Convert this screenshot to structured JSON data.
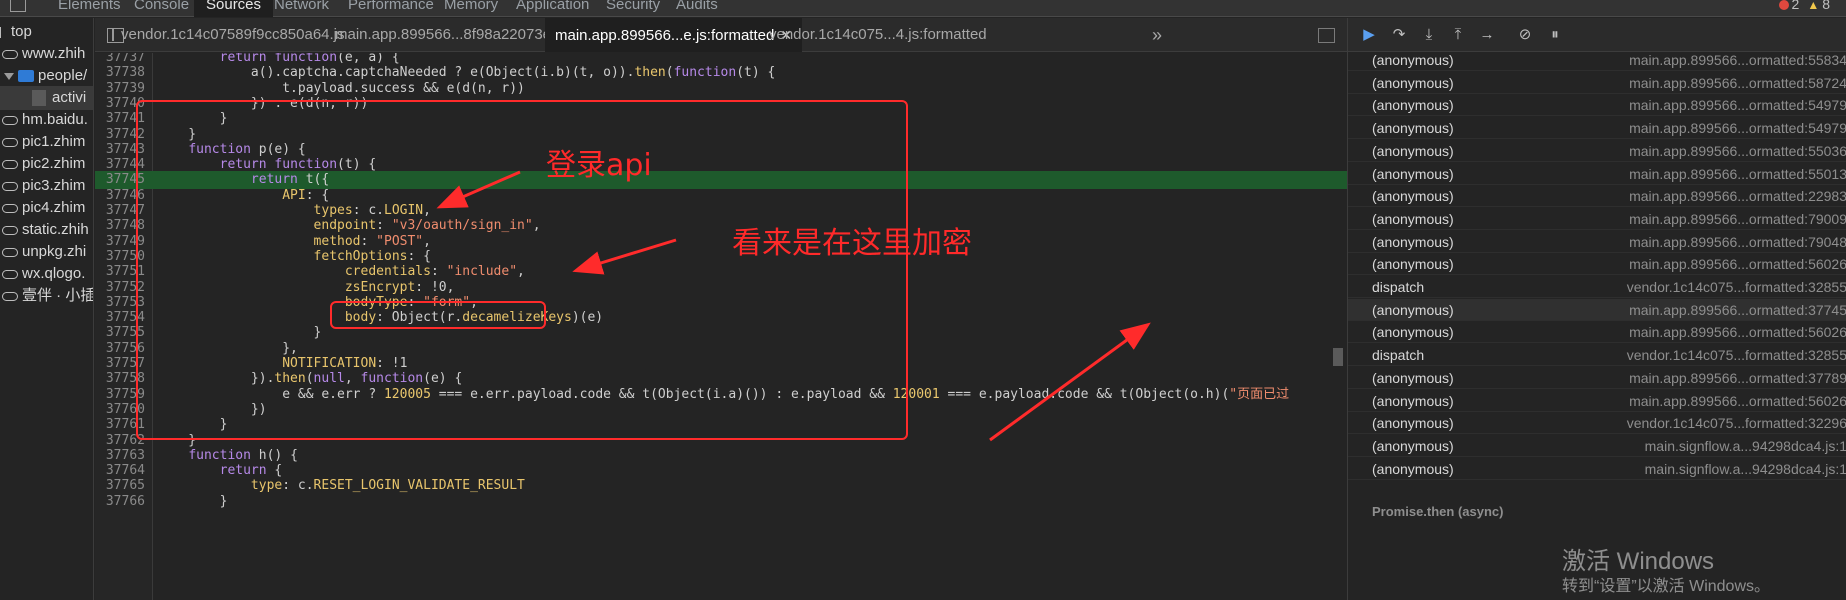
{
  "top_tabs": {
    "items": [
      "Elements",
      "Console",
      "Sources",
      "Network",
      "Performance",
      "Memory",
      "Application",
      "Security",
      "Audits"
    ],
    "active": "Sources",
    "errors": "2",
    "warnings": "8"
  },
  "navigator": {
    "items": [
      {
        "label": "top",
        "icon": "frame-icon"
      },
      {
        "label": "www.zhih",
        "icon": "cloud-icon"
      },
      {
        "label": "people/",
        "icon": "folder-icon"
      },
      {
        "label": "activi",
        "icon": "file-icon"
      },
      {
        "label": "hm.baidu.",
        "icon": "cloud-icon"
      },
      {
        "label": "pic1.zhim",
        "icon": "cloud-icon"
      },
      {
        "label": "pic2.zhim",
        "icon": "cloud-icon"
      },
      {
        "label": "pic3.zhim",
        "icon": "cloud-icon"
      },
      {
        "label": "pic4.zhim",
        "icon": "cloud-icon"
      },
      {
        "label": "static.zhih",
        "icon": "cloud-icon"
      },
      {
        "label": "unpkg.zhi",
        "icon": "cloud-icon"
      },
      {
        "label": "wx.qlogo.",
        "icon": "cloud-icon"
      },
      {
        "label": "壹伴 · 小插",
        "icon": "cloud-icon"
      }
    ]
  },
  "editor_tabs": {
    "items": [
      "vendor.1c14c07589f9cc850a64.js",
      "main.app.899566...8f98a22073e.js",
      "main.app.899566...e.js:formatted",
      "vendor.1c14c075...4.js:formatted"
    ],
    "active_index": 2,
    "more": "»"
  },
  "code": {
    "lines": [
      {
        "n": "37737",
        "html": "        <span class='k'>return</span> <span class='k'>function</span>(e, a) {"
      },
      {
        "n": "37738",
        "html": "            a().captcha.captchaNeeded ? e(Object(i.b)(t, o)).<span class='n'>then</span>(<span class='k'>function</span>(t) {"
      },
      {
        "n": "37739",
        "html": "                t.payload.success &amp;&amp; e(d(n, r))"
      },
      {
        "n": "37740",
        "html": "            }) : e(d(n, r))"
      },
      {
        "n": "37741",
        "html": "        }"
      },
      {
        "n": "37742",
        "html": "    }"
      },
      {
        "n": "37743",
        "html": "    <span class='k'>function</span> p(e) {"
      },
      {
        "n": "37744",
        "html": "        <span class='k'>return</span> <span class='k'>function</span>(t) {"
      },
      {
        "n": "37745",
        "html": "            <span class='k'>return</span> t({"
      },
      {
        "n": "37746",
        "html": "                <span class='p'>API</span>: {"
      },
      {
        "n": "37747",
        "html": "                    <span class='p'>types</span>: c.<span class='p'>LOGIN</span>,"
      },
      {
        "n": "37748",
        "html": "                    <span class='p'>endpoint</span>: <span class='s'>\"v3/oauth/sign_in\"</span>,"
      },
      {
        "n": "37749",
        "html": "                    <span class='p'>method</span>: <span class='s'>\"POST\"</span>,"
      },
      {
        "n": "37750",
        "html": "                    <span class='p'>fetchOptions</span>: {"
      },
      {
        "n": "37751",
        "html": "                        <span class='p'>credentials</span>: <span class='s'>\"include\"</span>,"
      },
      {
        "n": "37752",
        "html": "                        <span class='p'>zsEncrypt</span>: !0,"
      },
      {
        "n": "37753",
        "html": "                        <span class='p'>bodyType</span>: <span class='s'>\"form\"</span>,"
      },
      {
        "n": "37754",
        "html": "                        <span class='p'>body</span>: Object(r.<span class='p'>decamelizeKeys</span>)(e)"
      },
      {
        "n": "37755",
        "html": "                    }"
      },
      {
        "n": "37756",
        "html": "                },"
      },
      {
        "n": "37757",
        "html": "                <span class='p'>NOTIFICATION</span>: !1"
      },
      {
        "n": "37758",
        "html": "            }).<span class='n'>then</span>(<span class='k'>null</span>, <span class='k'>function</span>(e) {"
      },
      {
        "n": "37759",
        "html": "                e &amp;&amp; e.err ? <span class='n'>120005</span> === e.err.payload.code &amp;&amp; t(Object(i.a)()) : e.payload &amp;&amp; <span class='n'>120001</span> === e.payload.code &amp;&amp; t(Object(o.h)(<span class='s'>\"页面已过</span>"
      },
      {
        "n": "37760",
        "html": "            })"
      },
      {
        "n": "37761",
        "html": "        }"
      },
      {
        "n": "37762",
        "html": "    }"
      },
      {
        "n": "37763",
        "html": "    <span class='k'>function</span> h() {"
      },
      {
        "n": "37764",
        "html": "        <span class='k'>return</span> {"
      },
      {
        "n": "37765",
        "html": "            <span class='p'>type</span>: c.<span class='p'>RESET_LOGIN_VALIDATE_RESULT</span>"
      },
      {
        "n": "37766",
        "html": "        }"
      }
    ],
    "highlight_line": "37745"
  },
  "annotations": {
    "login_api": "登录api",
    "encrypt_here": "看来是在这里加密"
  },
  "call_stack": {
    "frames": [
      {
        "fn": "(anonymous)",
        "loc": "main.app.899566...ormatted:55834"
      },
      {
        "fn": "(anonymous)",
        "loc": "main.app.899566...ormatted:58724"
      },
      {
        "fn": "(anonymous)",
        "loc": "main.app.899566...ormatted:54979"
      },
      {
        "fn": "(anonymous)",
        "loc": "main.app.899566...ormatted:54979"
      },
      {
        "fn": "(anonymous)",
        "loc": "main.app.899566...ormatted:55036"
      },
      {
        "fn": "(anonymous)",
        "loc": "main.app.899566...ormatted:55013"
      },
      {
        "fn": "(anonymous)",
        "loc": "main.app.899566...ormatted:22983"
      },
      {
        "fn": "(anonymous)",
        "loc": "main.app.899566...ormatted:79009"
      },
      {
        "fn": "(anonymous)",
        "loc": "main.app.899566...ormatted:79048"
      },
      {
        "fn": "(anonymous)",
        "loc": "main.app.899566...ormatted:56026"
      },
      {
        "fn": "dispatch",
        "loc": "vendor.1c14c075...formatted:32855"
      },
      {
        "fn": "(anonymous)",
        "loc": "main.app.899566...ormatted:37745"
      },
      {
        "fn": "(anonymous)",
        "loc": "main.app.899566...ormatted:56026"
      },
      {
        "fn": "dispatch",
        "loc": "vendor.1c14c075...formatted:32855"
      },
      {
        "fn": "(anonymous)",
        "loc": "main.app.899566...ormatted:37789"
      },
      {
        "fn": "(anonymous)",
        "loc": "main.app.899566...ormatted:56026"
      },
      {
        "fn": "(anonymous)",
        "loc": "vendor.1c14c075...formatted:32296"
      },
      {
        "fn": "(anonymous)",
        "loc": "main.signflow.a...94298dca4.js:1"
      },
      {
        "fn": "(anonymous)",
        "loc": "main.signflow.a...94298dca4.js:1"
      }
    ],
    "selected_index": 11,
    "async_label": "Promise.then (async)"
  },
  "watermark": {
    "line1": "激活 Windows",
    "line2": "转到“设置”以激活 Windows。"
  },
  "colors": {
    "annotation_red": "#ff2b2b",
    "highlight_green": "#1e5a2c",
    "keyword": "#b689e8",
    "string": "#f08d6e"
  }
}
